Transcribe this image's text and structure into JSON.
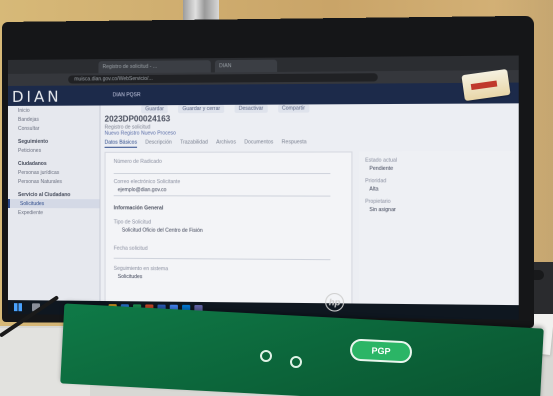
{
  "browser": {
    "tabs": [
      "Registro de solicitud - ...",
      "DIAN"
    ],
    "url": "muisca.dian.gov.co/WebServicio/..."
  },
  "app": {
    "brand": "DIAN",
    "brand_sub": "DIAN PQSR"
  },
  "sidebar": {
    "items": [
      {
        "label": "Inicio",
        "kind": "item"
      },
      {
        "label": "Bandejas",
        "kind": "item"
      },
      {
        "label": "Consultar",
        "kind": "item"
      },
      {
        "label": "Seguimiento",
        "kind": "head"
      },
      {
        "label": "Peticiones",
        "kind": "item"
      },
      {
        "label": "Ciudadanos",
        "kind": "head"
      },
      {
        "label": "Personas jurídicas",
        "kind": "item"
      },
      {
        "label": "Personas Naturales",
        "kind": "item"
      },
      {
        "label": "Servicio al Ciudadano",
        "kind": "head"
      },
      {
        "label": "Solicitudes",
        "kind": "active"
      },
      {
        "label": "Expediente",
        "kind": "item"
      }
    ]
  },
  "main": {
    "buttons": [
      "Guardar",
      "Guardar y cerrar",
      "Desactivar",
      "Compartir"
    ],
    "title": "2023DP00024163",
    "subtitle": "Registro de solicitud",
    "subtitle2": "Nuevo Registro Nuevo Proceso",
    "tabs": [
      "Datos Básicos",
      "Descripción",
      "Trazabilidad",
      "Archivos",
      "Documentos",
      "Respuesta"
    ],
    "fields": [
      {
        "label": "Número de Radicado",
        "value": ""
      },
      {
        "label": "Correo electrónico Solicitante",
        "value": "ejemplo@dian.gov.co"
      },
      {
        "label": "Información General",
        "value": ""
      },
      {
        "label": "Tipo de Solicitud",
        "value": "Solicitud Oficio del Centro de Fisión"
      },
      {
        "label": "Fecha solicitud",
        "value": ""
      },
      {
        "label": "Seguimiento en sistema",
        "value": "Solicitudes"
      }
    ],
    "right_panel": [
      {
        "label": "Estado actual",
        "value": "Pendiente"
      },
      {
        "label": "Prioridad",
        "value": "Alta"
      },
      {
        "label": "Propietario",
        "value": "Sin asignar"
      }
    ]
  },
  "desk": {
    "folder_badge": "PGP"
  }
}
